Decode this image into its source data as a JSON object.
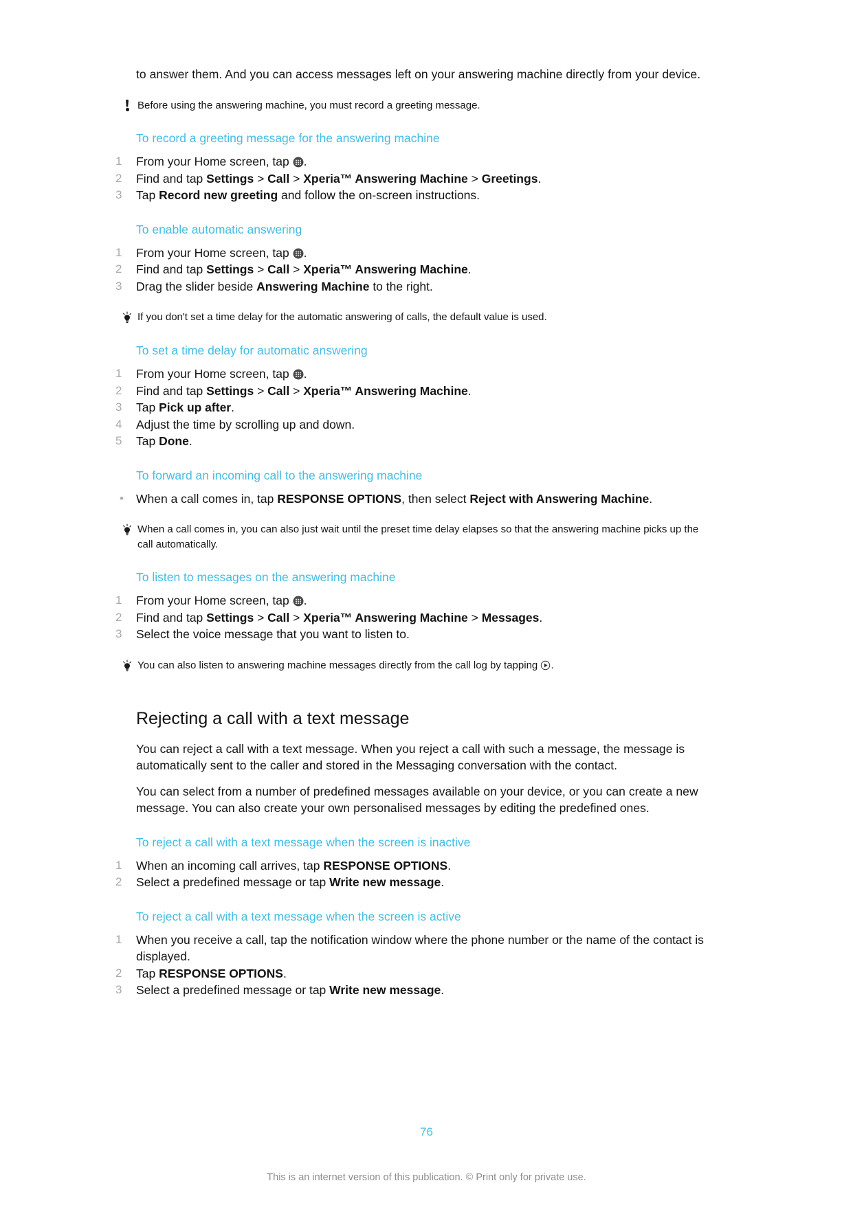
{
  "document": {
    "intro_paragraph": "to answer them. And you can access messages left on your answering machine directly from your device.",
    "note_before_using": "Before using the answering machine, you must record a greeting message.",
    "section_heading": "Rejecting a call with a text message",
    "section_paragraph_1": "You can reject a call with a text message. When you reject a call with such a message, the message is automatically sent to the caller and stored in the Messaging conversation with the contact.",
    "section_paragraph_2": "You can select from a number of predefined messages available on your device, or you can create a new message. You can also create your own personalised messages by editing the predefined ones."
  },
  "procedures": {
    "record_greeting": {
      "heading": "To record a greeting message for the answering machine",
      "steps": [
        {
          "num": "1",
          "pre": "From your Home screen, tap ",
          "icon": "app-drawer-icon",
          "post": "."
        },
        {
          "num": "2",
          "parts": [
            {
              "t": "Find and tap ",
              "b": false
            },
            {
              "t": "Settings",
              "b": true
            },
            {
              "t": " > ",
              "b": false
            },
            {
              "t": "Call",
              "b": true
            },
            {
              "t": " > ",
              "b": false
            },
            {
              "t": "Xperia™ Answering Machine",
              "b": true
            },
            {
              "t": " > ",
              "b": false
            },
            {
              "t": "Greetings",
              "b": true
            },
            {
              "t": ".",
              "b": false
            }
          ]
        },
        {
          "num": "3",
          "parts": [
            {
              "t": "Tap ",
              "b": false
            },
            {
              "t": "Record new greeting",
              "b": true
            },
            {
              "t": " and follow the on-screen instructions.",
              "b": false
            }
          ]
        }
      ]
    },
    "enable_auto_answering": {
      "heading": "To enable automatic answering",
      "steps": [
        {
          "num": "1",
          "pre": "From your Home screen, tap ",
          "icon": "app-drawer-icon",
          "post": "."
        },
        {
          "num": "2",
          "parts": [
            {
              "t": "Find and tap ",
              "b": false
            },
            {
              "t": "Settings",
              "b": true
            },
            {
              "t": " > ",
              "b": false
            },
            {
              "t": "Call",
              "b": true
            },
            {
              "t": " > ",
              "b": false
            },
            {
              "t": "Xperia™ Answering Machine",
              "b": true
            },
            {
              "t": ".",
              "b": false
            }
          ]
        },
        {
          "num": "3",
          "parts": [
            {
              "t": "Drag the slider beside ",
              "b": false
            },
            {
              "t": "Answering Machine",
              "b": true
            },
            {
              "t": " to the right.",
              "b": false
            }
          ]
        }
      ],
      "tip": "If you don't set a time delay for the automatic answering of calls, the default value is used."
    },
    "set_time_delay": {
      "heading": "To set a time delay for automatic answering",
      "steps": [
        {
          "num": "1",
          "pre": "From your Home screen, tap ",
          "icon": "app-drawer-icon",
          "post": "."
        },
        {
          "num": "2",
          "parts": [
            {
              "t": "Find and tap ",
              "b": false
            },
            {
              "t": "Settings",
              "b": true
            },
            {
              "t": " > ",
              "b": false
            },
            {
              "t": "Call",
              "b": true
            },
            {
              "t": " > ",
              "b": false
            },
            {
              "t": "Xperia™ Answering Machine",
              "b": true
            },
            {
              "t": ".",
              "b": false
            }
          ]
        },
        {
          "num": "3",
          "parts": [
            {
              "t": "Tap ",
              "b": false
            },
            {
              "t": "Pick up after",
              "b": true
            },
            {
              "t": ".",
              "b": false
            }
          ]
        },
        {
          "num": "4",
          "parts": [
            {
              "t": "Adjust the time by scrolling up and down.",
              "b": false
            }
          ]
        },
        {
          "num": "5",
          "parts": [
            {
              "t": "Tap ",
              "b": false
            },
            {
              "t": "Done",
              "b": true
            },
            {
              "t": ".",
              "b": false
            }
          ]
        }
      ]
    },
    "forward_incoming_call": {
      "heading": "To forward an incoming call to the answering machine",
      "bullet_steps": [
        {
          "num": "•",
          "parts": [
            {
              "t": "When a call comes in, tap ",
              "b": false
            },
            {
              "t": "RESPONSE OPTIONS",
              "b": true
            },
            {
              "t": ", then select ",
              "b": false
            },
            {
              "t": "Reject with Answering Machine",
              "b": true
            },
            {
              "t": ".",
              "b": false
            }
          ]
        }
      ],
      "tip": "When a call comes in, you can also just wait until the preset time delay elapses so that the answering machine picks up the call automatically."
    },
    "listen_to_messages": {
      "heading": "To listen to messages on the answering machine",
      "steps": [
        {
          "num": "1",
          "pre": "From your Home screen, tap ",
          "icon": "app-drawer-icon",
          "post": "."
        },
        {
          "num": "2",
          "parts": [
            {
              "t": "Find and tap ",
              "b": false
            },
            {
              "t": "Settings",
              "b": true
            },
            {
              "t": " > ",
              "b": false
            },
            {
              "t": "Call",
              "b": true
            },
            {
              "t": " > ",
              "b": false
            },
            {
              "t": "Xperia™ Answering Machine",
              "b": true
            },
            {
              "t": " > ",
              "b": false
            },
            {
              "t": "Messages",
              "b": true
            },
            {
              "t": ".",
              "b": false
            }
          ]
        },
        {
          "num": "3",
          "parts": [
            {
              "t": "Select the voice message that you want to listen to.",
              "b": false
            }
          ]
        }
      ],
      "tip_pre": "You can also listen to answering machine messages directly from the call log by tapping ",
      "tip_icon": "play-icon",
      "tip_post": "."
    },
    "reject_screen_inactive": {
      "heading": "To reject a call with a text message when the screen is inactive",
      "steps": [
        {
          "num": "1",
          "parts": [
            {
              "t": "When an incoming call arrives, tap ",
              "b": false
            },
            {
              "t": "RESPONSE OPTIONS",
              "b": true
            },
            {
              "t": ".",
              "b": false
            }
          ]
        },
        {
          "num": "2",
          "parts": [
            {
              "t": "Select a predefined message or tap ",
              "b": false
            },
            {
              "t": "Write new message",
              "b": true
            },
            {
              "t": ".",
              "b": false
            }
          ]
        }
      ]
    },
    "reject_screen_active": {
      "heading": "To reject a call with a text message when the screen is active",
      "steps": [
        {
          "num": "1",
          "parts": [
            {
              "t": "When you receive a call, tap the notification window where the phone number or the name of the contact is displayed.",
              "b": false
            }
          ]
        },
        {
          "num": "2",
          "parts": [
            {
              "t": "Tap ",
              "b": false
            },
            {
              "t": "RESPONSE OPTIONS",
              "b": true
            },
            {
              "t": ".",
              "b": false
            }
          ]
        },
        {
          "num": "3",
          "parts": [
            {
              "t": "Select a predefined message or tap ",
              "b": false
            },
            {
              "t": "Write new message",
              "b": true
            },
            {
              "t": ".",
              "b": false
            }
          ]
        }
      ]
    }
  },
  "footer": {
    "page_number": "76",
    "notice": "This is an internet version of this publication. © Print only for private use."
  },
  "colors": {
    "accent": "#45BDE3",
    "text": "#141414",
    "muted": "#8C8C8C",
    "step_number": "#AAAAAA"
  }
}
